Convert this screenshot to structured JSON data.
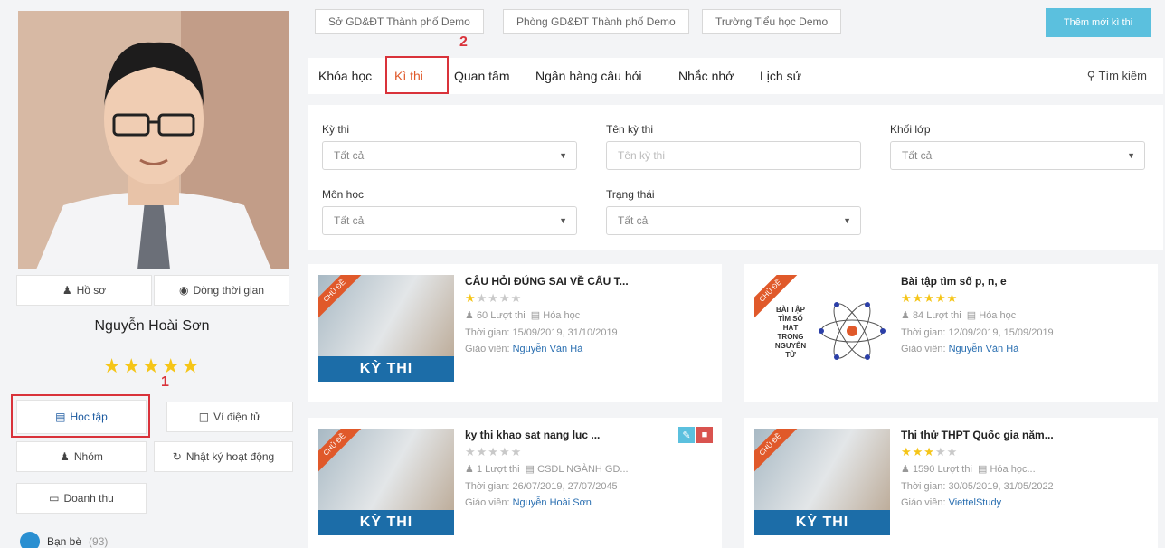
{
  "profile": {
    "name": "Nguyễn Hoài Sơn",
    "stars": "★★★★★",
    "btn_profile": "Hồ sơ",
    "btn_timeline": "Dòng thời gian",
    "menu_study": "Học tập",
    "menu_wallet": "Ví điện tử",
    "menu_group": "Nhóm",
    "menu_log": "Nhật ký hoạt động",
    "menu_revenue": "Doanh thu",
    "friends_label": "Bạn bè",
    "friends_count": "(93)",
    "marker1": "1"
  },
  "breadcrumb": [
    "Sở GD&ĐT Thành phố Demo",
    "Phòng GD&ĐT Thành phố Demo",
    "Trường Tiểu học Demo"
  ],
  "add_button": "Thêm mới kì thi",
  "tabs": {
    "courses": "Khóa học",
    "exams": "Kì thi",
    "interest": "Quan tâm",
    "question_bank": "Ngân hàng câu hỏi",
    "reminder": "Nhắc nhở",
    "history": "Lịch sử",
    "search": "Tìm kiếm",
    "marker2": "2"
  },
  "filters": {
    "exam_label": "Kỳ thi",
    "exam_value": "Tất cả",
    "name_label": "Tên kỳ thi",
    "name_placeholder": "Tên kỳ thi",
    "grade_label": "Khối lớp",
    "grade_value": "Tất cả",
    "subject_label": "Môn học",
    "subject_value": "Tất cả",
    "status_label": "Trạng thái",
    "status_value": "Tất cả"
  },
  "cards": [
    {
      "title": "CÂU HỎI ĐÚNG SAI VỀ CẤU T...",
      "rating": 1,
      "views": "60 Lượt thi",
      "subject": "Hóa học",
      "time": "Thời gian: 15/09/2019, 31/10/2019",
      "teacher_label": "Giáo viên:",
      "teacher": "Nguyễn Văn Hà",
      "band": "KỲ THI",
      "ribbon": "CHỦ ĐỀ"
    },
    {
      "title": "Bài tập tìm số p, n, e",
      "rating": 5,
      "views": "84 Lượt thi",
      "subject": "Hóa học",
      "time": "Thời gian: 12/09/2019, 15/09/2019",
      "teacher_label": "Giáo viên:",
      "teacher": "Nguyễn Văn Hà",
      "thumb_text": "BÀI TẬP TÌM SỐ HẠT TRONG NGUYÊN TỬ",
      "ribbon": "CHỦ ĐỀ"
    },
    {
      "title": "ky thi khao sat nang luc ...",
      "rating": 0,
      "views": "1 Lượt thi",
      "subject": "CSDL NGÀNH GD...",
      "time": "Thời gian: 26/07/2019, 27/07/2045",
      "teacher_label": "Giáo viên:",
      "teacher": "Nguyễn Hoài Sơn",
      "band": "KỲ THI",
      "ribbon": "CHỦ ĐỀ"
    },
    {
      "title": "Thi thử THPT Quốc gia năm...",
      "rating": 3,
      "views": "1590 Lượt thi",
      "subject": "Hóa học...",
      "time": "Thời gian: 30/05/2019, 31/05/2022",
      "teacher_label": "Giáo viên:",
      "teacher": "ViettelStudy",
      "band": "KỲ THI",
      "ribbon": "CHỦ ĐỀ"
    }
  ]
}
